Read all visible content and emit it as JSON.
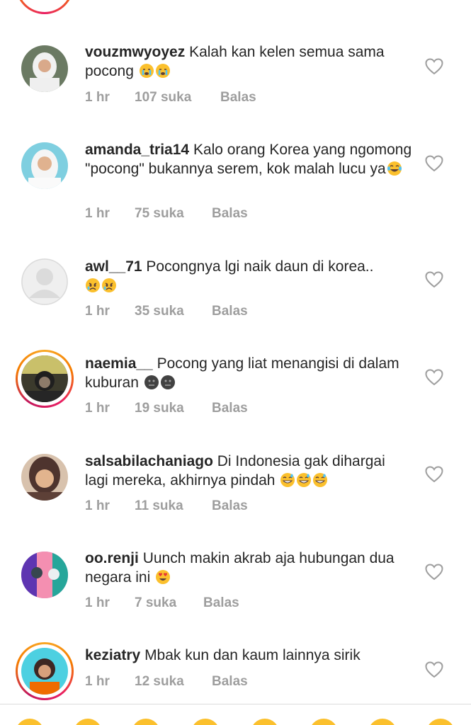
{
  "comments": [
    {
      "username": "vouzmwyoyez",
      "text": "Kalah kan kelen semua sama pocong",
      "emojis": [
        "crying-face",
        "crying-face"
      ],
      "time": "1 hr",
      "likes": "107 suka",
      "reply": "Balas"
    },
    {
      "username": "amanda_tria14",
      "text": "Kalo orang Korea yang ngomong \"pocong\" bukannya serem, kok malah lucu ya",
      "emojis": [
        "tears-of-joy"
      ],
      "time": "1 hr",
      "likes": "75 suka",
      "reply": "Balas"
    },
    {
      "username": "awl__71",
      "text": "Pocongnya lgi naik daun di korea..",
      "emojis": [
        "crying-face",
        "crying-face"
      ],
      "time": "1 hr",
      "likes": "35 suka",
      "reply": "Balas"
    },
    {
      "username": "naemia__",
      "text": "Pocong yang liat menangisi di dalam kuburan",
      "emojis": [
        "dark-face",
        "dark-face"
      ],
      "time": "1 hr",
      "likes": "19 suka",
      "reply": "Balas"
    },
    {
      "username": "salsabilachaniago",
      "text": "Di Indonesia gak dihargai lagi mereka, akhirnya pindah",
      "emojis": [
        "grinning-sweat",
        "grinning-sweat",
        "grinning-sweat"
      ],
      "time": "1 hr",
      "likes": "11 suka",
      "reply": "Balas"
    },
    {
      "username": "oo.renji",
      "text": "Uunch makin akrab aja hubungan dua negara ini",
      "emojis": [
        "heart-eyes"
      ],
      "time": "1 hr",
      "likes": "7 suka",
      "reply": "Balas"
    },
    {
      "username": "keziatry",
      "text": "Mbak kun dan kaum lainnya sirik",
      "emojis": [],
      "time": "1 hr",
      "likes": "12 suka",
      "reply": "Balas"
    }
  ],
  "icons": {
    "like": "heart-outline-icon"
  },
  "colors": {
    "text": "#262626",
    "meta": "#9e9e9e",
    "story_ring": "#e91e63"
  }
}
